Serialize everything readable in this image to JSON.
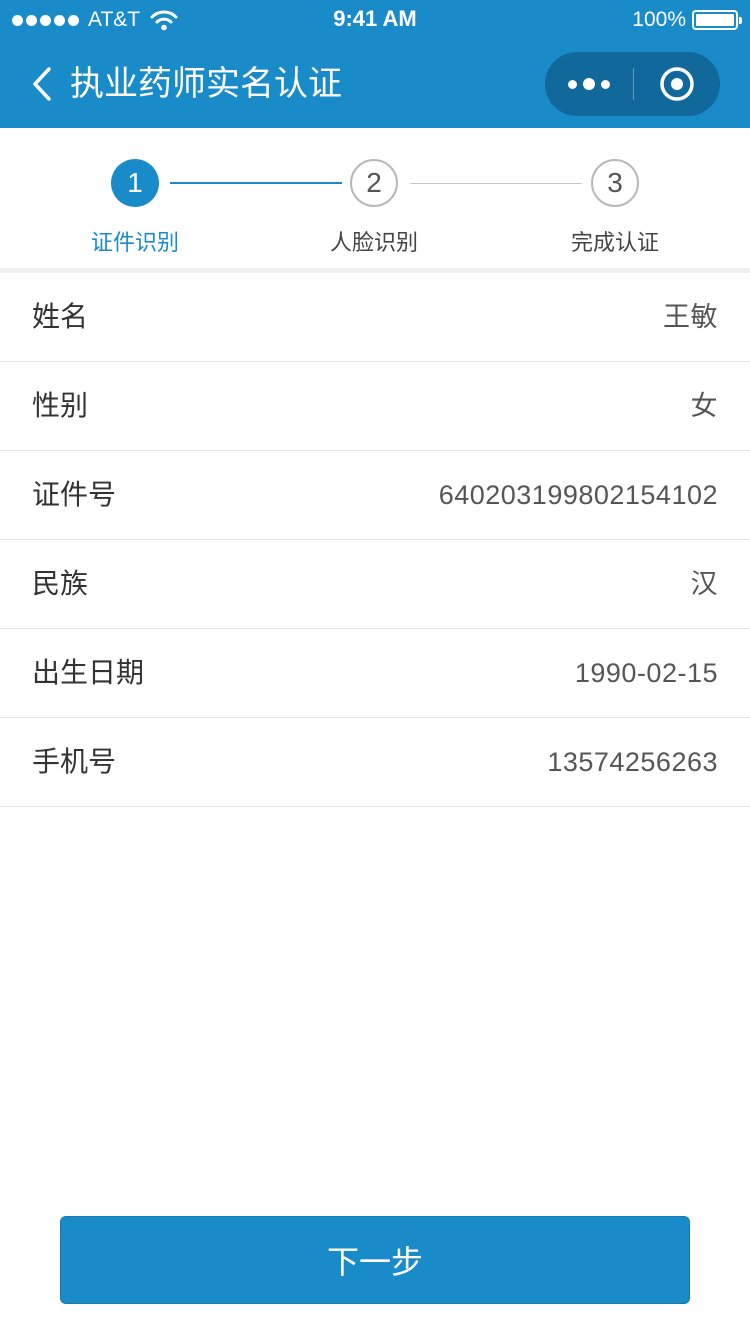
{
  "status_bar": {
    "carrier": "AT&T",
    "time": "9:41 AM",
    "battery": "100%"
  },
  "nav": {
    "title": "执业药师实名认证",
    "back_icon": "chevron-left-icon",
    "more_icon": "more-dots-icon",
    "close_icon": "target-close-icon"
  },
  "steps": [
    {
      "number": "1",
      "label": "证件识别",
      "active": true
    },
    {
      "number": "2",
      "label": "人脸识别",
      "active": false
    },
    {
      "number": "3",
      "label": "完成认证",
      "active": false
    }
  ],
  "info": [
    {
      "label": "姓名",
      "value": "王敏"
    },
    {
      "label": "性别",
      "value": "女"
    },
    {
      "label": "证件号",
      "value": "640203199802154102"
    },
    {
      "label": "民族",
      "value": "汉"
    },
    {
      "label": "出生日期",
      "value": "1990-02-15"
    },
    {
      "label": "手机号",
      "value": "13574256263"
    }
  ],
  "next_button": "下一步",
  "colors": {
    "primary": "#1a8bc9",
    "step_active_text": "#1a8bc9",
    "step_idle_border": "#b8b8b8",
    "divider": "#e8e8e8"
  }
}
